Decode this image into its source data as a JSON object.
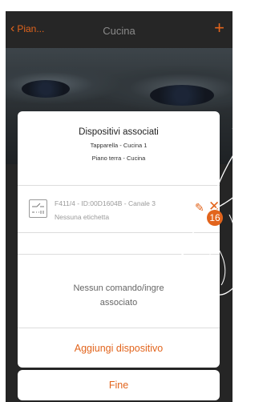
{
  "header": {
    "back_label": "Pian...",
    "title": "Cucina",
    "add_icon": "plus-icon"
  },
  "card": {
    "title": "Dispositivi associati",
    "subtitle1": "Tapparella - Cucina 1",
    "subtitle2": "Piano terra - Cucina",
    "device": {
      "name": "F411/4 - ID:00D1604B - Canale 3",
      "label": "Nessuna etichetta",
      "icon": "switch-device-icon"
    },
    "empty_line1": "Nessun comando/ingre",
    "empty_line2": "associato",
    "add_button": "Aggiungi dispositivo"
  },
  "done_button": "Fine",
  "step_badge": "16",
  "colors": {
    "accent": "#e2641c",
    "header": "#262626"
  }
}
